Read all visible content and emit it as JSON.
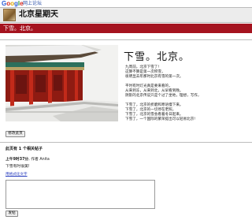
{
  "topbar": {
    "logo_parts": [
      "G",
      "o",
      "o",
      "g",
      "l",
      "e"
    ],
    "product": "网上论坛"
  },
  "group": {
    "title": "北京星期天",
    "banner": "下雪。北京。"
  },
  "post": {
    "title": "下雪。北京。",
    "lines": [
      "九周前，北京下雪了!",
      "这算不算是第一次积雪，",
      "很明显去年那时北京有雪的第一次。",
      "",
      "平时有时灯光真是要来看的，",
      "从来到冻，从来到北，从早看到晚。",
      "阴影的北京传说只是个过了坐地，理想，写作，",
      "",
      "下雪了，北京的折磨和寒语慢下来。",
      "下雪了，北京的一切停在老照，",
      "下雪了，北京的雪会看着冬日起来。",
      "下雪了，一个国际的繁荣提出可以轻易北京!"
    ],
    "edit_button": "修改此页"
  },
  "reply": {
    "section_title": "此页有 1 个相关帖子",
    "time": "上午9时37分",
    "by_label": ", 作者",
    "author": "Anita",
    "message": "下雪有时很美!",
    "rich_text_link": "用格式化文字",
    "input_value": "",
    "submit_button": "发帖"
  },
  "colors": {
    "banner_bg": "#a5131f",
    "link": "#2a3fbf",
    "header_bg": "#ececec"
  },
  "icons": {
    "group_avatar": "group-avatar-image",
    "photo": "forbidden-city-snow-photo"
  }
}
